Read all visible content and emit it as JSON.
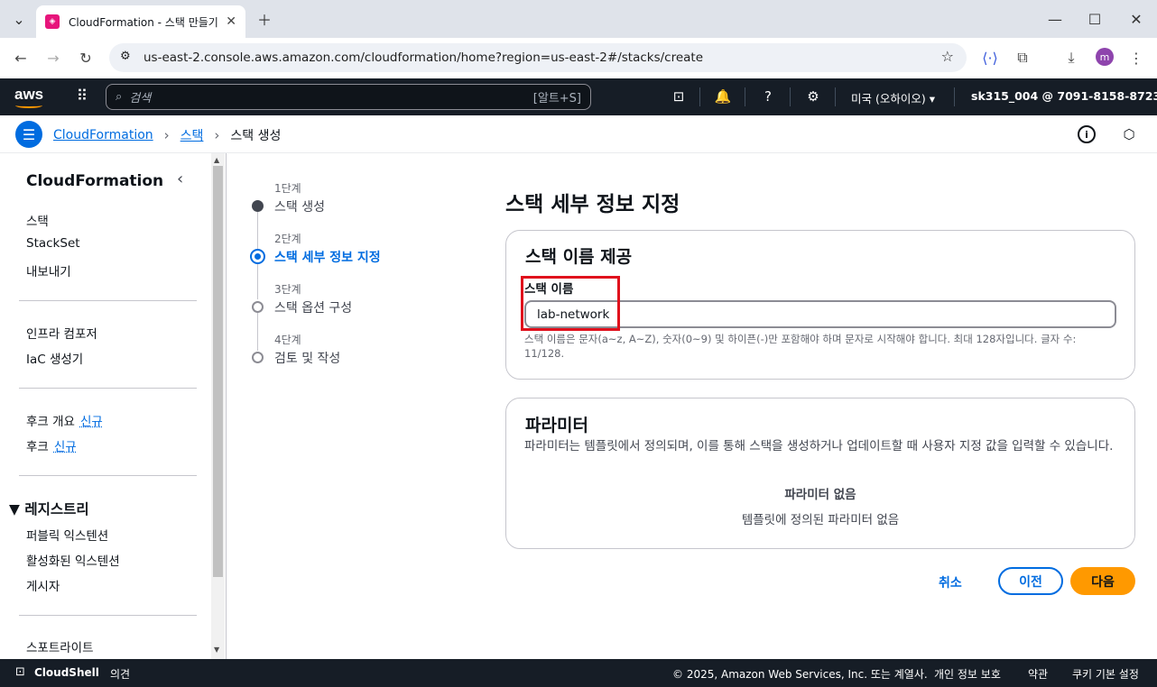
{
  "browser": {
    "tab_title": "CloudFormation - 스택 만들기",
    "url": "us-east-2.console.aws.amazon.com/cloudformation/home?region=us-east-2#/stacks/create",
    "profile_initial": "m"
  },
  "aws_nav": {
    "logo": "aws",
    "search_placeholder": "검색",
    "search_shortcut": "[알트+S]",
    "region": "미국 (오하이오) ▾",
    "account": "sk315_004 @ 7091-8158-8723 ▾"
  },
  "breadcrumb": {
    "items": [
      "CloudFormation",
      "스택",
      "스택 생성"
    ]
  },
  "sidebar": {
    "title": "CloudFormation",
    "group1": [
      "스택",
      "StackSet",
      "내보내기"
    ],
    "group2": [
      "인프라 컴포저",
      "IaC 생성기"
    ],
    "hooks_overview": "후크 개요",
    "hooks": "후크",
    "new_badge": "신규",
    "registry_section": "▼ 레지스트리",
    "registry_items": [
      "퍼블릭 익스텐션",
      "활성화된 익스텐션",
      "게시자"
    ],
    "spotlight": "스포트라이트"
  },
  "steps": [
    {
      "num": "1단계",
      "label": "스택 생성",
      "state": "done"
    },
    {
      "num": "2단계",
      "label": "스택 세부 정보 지정",
      "state": "active"
    },
    {
      "num": "3단계",
      "label": "스택 옵션 구성",
      "state": "pending"
    },
    {
      "num": "4단계",
      "label": "검토 및 작성",
      "state": "pending"
    }
  ],
  "main": {
    "page_title": "스택 세부 정보 지정",
    "stack_name_card": {
      "heading": "스택 이름 제공",
      "label": "스택 이름",
      "value": "lab-network",
      "hint": "스택 이름은 문자(a~z, A~Z), 숫자(0~9) 및 하이픈(-)만 포함해야 하며 문자로 시작해야 합니다. 최대 128자입니다. 글자 수: 11/128."
    },
    "params_card": {
      "heading": "파라미터",
      "description": "파라미터는 템플릿에서 정의되며, 이를 통해 스택을 생성하거나 업데이트할 때 사용자 지정 값을 입력할 수 있습니다.",
      "empty_title": "파라미터 없음",
      "empty_desc": "템플릿에 정의된 파라미터 없음"
    },
    "actions": {
      "cancel": "취소",
      "previous": "이전",
      "next": "다음"
    }
  },
  "footer": {
    "cloudshell": "CloudShell",
    "feedback": "의견",
    "copyright": "© 2025, Amazon Web Services, Inc. 또는 계열사.",
    "privacy": "개인 정보 보호",
    "terms": "약관",
    "cookies": "쿠키 기본 설정"
  },
  "colors": {
    "accent": "#006ce0",
    "primary_button": "#ff9900",
    "nav_bg": "#161d26",
    "highlight": "#e0101c"
  }
}
